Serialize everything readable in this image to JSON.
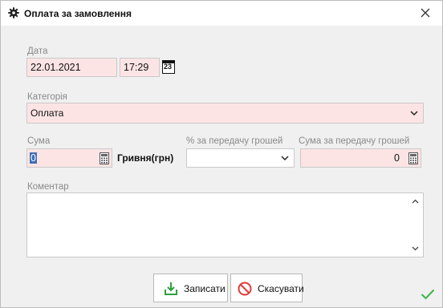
{
  "window": {
    "title": "Оплата за замовлення"
  },
  "date": {
    "label": "Дата",
    "date_value": "22.01.2021",
    "time_value": "17:29",
    "calendar_day": "23"
  },
  "category": {
    "label": "Категорія",
    "value": "Оплата"
  },
  "sum": {
    "label": "Сума",
    "value": "0",
    "currency": "Гривня(грн)"
  },
  "transfer_percent": {
    "label": "% за передачу грошей",
    "value": ""
  },
  "transfer_sum": {
    "label": "Сума за передачу грошей",
    "value": "0"
  },
  "comment": {
    "label": "Коментар",
    "value": ""
  },
  "buttons": {
    "save": "Записати",
    "cancel": "Скасувати"
  },
  "colors": {
    "required_field": "#fde4e4",
    "save_icon": "#2e9e3e",
    "cancel_icon": "#e23b3b",
    "ok_check": "#39b54a"
  }
}
